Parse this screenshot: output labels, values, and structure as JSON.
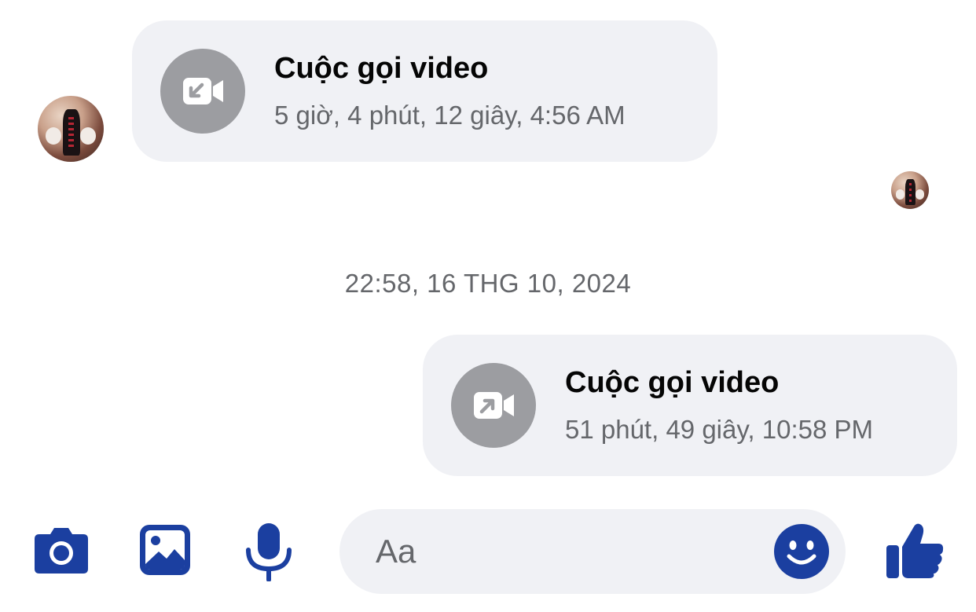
{
  "messages": {
    "incoming_call": {
      "title": "Cuộc gọi video",
      "subtitle": "5 giờ, 4 phút, 12 giây, 4:56 AM",
      "icon": "incoming-video-call-icon"
    },
    "timestamp_divider": "22:58, 16 THG 10, 2024",
    "outgoing_call": {
      "title": "Cuộc gọi video",
      "subtitle": "51 phút, 49 giây, 10:58 PM",
      "icon": "outgoing-video-call-icon"
    }
  },
  "composer": {
    "placeholder": "Aa",
    "buttons": [
      "camera-icon",
      "gallery-icon",
      "microphone-icon",
      "emoji-icon",
      "thumbs-up-icon"
    ]
  },
  "colors": {
    "accent": "#1b3fa0",
    "bubble": "#f0f1f5",
    "call_icon_bg": "#9c9da1",
    "secondary_text": "#65676b"
  }
}
